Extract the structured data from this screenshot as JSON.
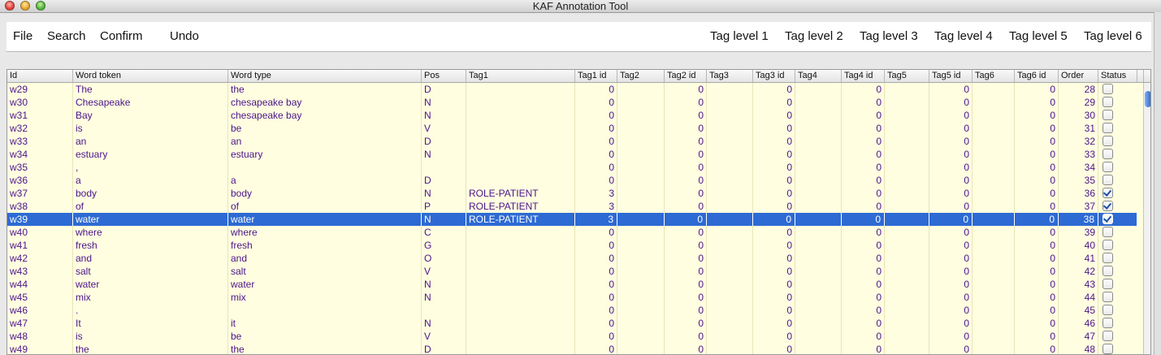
{
  "window": {
    "title": "KAF Annotation Tool"
  },
  "menu": {
    "left": [
      "File",
      "Search",
      "Confirm",
      "Undo"
    ],
    "right": [
      "Tag level 1",
      "Tag level 2",
      "Tag level 3",
      "Tag level 4",
      "Tag level 5",
      "Tag level 6"
    ]
  },
  "colors": {
    "selection": "#2d6ad3",
    "row_bg": "#fffee0",
    "text": "#4a148c"
  },
  "table": {
    "columns": [
      "Id",
      "Word token",
      "Word type",
      "Pos",
      "Tag1",
      "Tag1 id",
      "Tag2",
      "Tag2 id",
      "Tag3",
      "Tag3 id",
      "Tag4",
      "Tag4 id",
      "Tag5",
      "Tag5 id",
      "Tag6",
      "Tag6 id",
      "Order",
      "Status"
    ],
    "selected_id": "w39",
    "rows": [
      {
        "id": "w29",
        "token": "The",
        "type": "the",
        "pos": "D",
        "tag1": "",
        "tag1_id": "0",
        "tag2_id": "0",
        "tag3_id": "0",
        "tag4_id": "0",
        "tag5_id": "0",
        "tag6_id": "0",
        "order": "28",
        "status": false
      },
      {
        "id": "w30",
        "token": "Chesapeake",
        "type": "chesapeake bay",
        "pos": "N",
        "tag1": "",
        "tag1_id": "0",
        "tag2_id": "0",
        "tag3_id": "0",
        "tag4_id": "0",
        "tag5_id": "0",
        "tag6_id": "0",
        "order": "29",
        "status": false
      },
      {
        "id": "w31",
        "token": "Bay",
        "type": "chesapeake bay",
        "pos": "N",
        "tag1": "",
        "tag1_id": "0",
        "tag2_id": "0",
        "tag3_id": "0",
        "tag4_id": "0",
        "tag5_id": "0",
        "tag6_id": "0",
        "order": "30",
        "status": false
      },
      {
        "id": "w32",
        "token": "is",
        "type": "be",
        "pos": "V",
        "tag1": "",
        "tag1_id": "0",
        "tag2_id": "0",
        "tag3_id": "0",
        "tag4_id": "0",
        "tag5_id": "0",
        "tag6_id": "0",
        "order": "31",
        "status": false
      },
      {
        "id": "w33",
        "token": "an",
        "type": "an",
        "pos": "D",
        "tag1": "",
        "tag1_id": "0",
        "tag2_id": "0",
        "tag3_id": "0",
        "tag4_id": "0",
        "tag5_id": "0",
        "tag6_id": "0",
        "order": "32",
        "status": false
      },
      {
        "id": "w34",
        "token": "estuary",
        "type": "estuary",
        "pos": "N",
        "tag1": "",
        "tag1_id": "0",
        "tag2_id": "0",
        "tag3_id": "0",
        "tag4_id": "0",
        "tag5_id": "0",
        "tag6_id": "0",
        "order": "33",
        "status": false
      },
      {
        "id": "w35",
        "token": ",",
        "type": "",
        "pos": "",
        "tag1": "",
        "tag1_id": "0",
        "tag2_id": "0",
        "tag3_id": "0",
        "tag4_id": "0",
        "tag5_id": "0",
        "tag6_id": "0",
        "order": "34",
        "status": false
      },
      {
        "id": "w36",
        "token": "a",
        "type": "a",
        "pos": "D",
        "tag1": "",
        "tag1_id": "0",
        "tag2_id": "0",
        "tag3_id": "0",
        "tag4_id": "0",
        "tag5_id": "0",
        "tag6_id": "0",
        "order": "35",
        "status": false
      },
      {
        "id": "w37",
        "token": "body",
        "type": "body",
        "pos": "N",
        "tag1": "ROLE-PATIENT",
        "tag1_id": "3",
        "tag2_id": "0",
        "tag3_id": "0",
        "tag4_id": "0",
        "tag5_id": "0",
        "tag6_id": "0",
        "order": "36",
        "status": true
      },
      {
        "id": "w38",
        "token": "of",
        "type": "of",
        "pos": "P",
        "tag1": "ROLE-PATIENT",
        "tag1_id": "3",
        "tag2_id": "0",
        "tag3_id": "0",
        "tag4_id": "0",
        "tag5_id": "0",
        "tag6_id": "0",
        "order": "37",
        "status": true
      },
      {
        "id": "w39",
        "token": "water",
        "type": "water",
        "pos": "N",
        "tag1": "ROLE-PATIENT",
        "tag1_id": "3",
        "tag2_id": "0",
        "tag3_id": "0",
        "tag4_id": "0",
        "tag5_id": "0",
        "tag6_id": "0",
        "order": "38",
        "status": true
      },
      {
        "id": "w40",
        "token": "where",
        "type": "where",
        "pos": "C",
        "tag1": "",
        "tag1_id": "0",
        "tag2_id": "0",
        "tag3_id": "0",
        "tag4_id": "0",
        "tag5_id": "0",
        "tag6_id": "0",
        "order": "39",
        "status": false
      },
      {
        "id": "w41",
        "token": "fresh",
        "type": "fresh",
        "pos": "G",
        "tag1": "",
        "tag1_id": "0",
        "tag2_id": "0",
        "tag3_id": "0",
        "tag4_id": "0",
        "tag5_id": "0",
        "tag6_id": "0",
        "order": "40",
        "status": false
      },
      {
        "id": "w42",
        "token": "and",
        "type": "and",
        "pos": "O",
        "tag1": "",
        "tag1_id": "0",
        "tag2_id": "0",
        "tag3_id": "0",
        "tag4_id": "0",
        "tag5_id": "0",
        "tag6_id": "0",
        "order": "41",
        "status": false
      },
      {
        "id": "w43",
        "token": "salt",
        "type": "salt",
        "pos": "V",
        "tag1": "",
        "tag1_id": "0",
        "tag2_id": "0",
        "tag3_id": "0",
        "tag4_id": "0",
        "tag5_id": "0",
        "tag6_id": "0",
        "order": "42",
        "status": false
      },
      {
        "id": "w44",
        "token": "water",
        "type": "water",
        "pos": "N",
        "tag1": "",
        "tag1_id": "0",
        "tag2_id": "0",
        "tag3_id": "0",
        "tag4_id": "0",
        "tag5_id": "0",
        "tag6_id": "0",
        "order": "43",
        "status": false
      },
      {
        "id": "w45",
        "token": "mix",
        "type": "mix",
        "pos": "N",
        "tag1": "",
        "tag1_id": "0",
        "tag2_id": "0",
        "tag3_id": "0",
        "tag4_id": "0",
        "tag5_id": "0",
        "tag6_id": "0",
        "order": "44",
        "status": false
      },
      {
        "id": "w46",
        "token": ".",
        "type": "",
        "pos": "",
        "tag1": "",
        "tag1_id": "0",
        "tag2_id": "0",
        "tag3_id": "0",
        "tag4_id": "0",
        "tag5_id": "0",
        "tag6_id": "0",
        "order": "45",
        "status": false
      },
      {
        "id": "w47",
        "token": "It",
        "type": "it",
        "pos": "N",
        "tag1": "",
        "tag1_id": "0",
        "tag2_id": "0",
        "tag3_id": "0",
        "tag4_id": "0",
        "tag5_id": "0",
        "tag6_id": "0",
        "order": "46",
        "status": false
      },
      {
        "id": "w48",
        "token": "is",
        "type": "be",
        "pos": "V",
        "tag1": "",
        "tag1_id": "0",
        "tag2_id": "0",
        "tag3_id": "0",
        "tag4_id": "0",
        "tag5_id": "0",
        "tag6_id": "0",
        "order": "47",
        "status": false
      },
      {
        "id": "w49",
        "token": "the",
        "type": "the",
        "pos": "D",
        "tag1": "",
        "tag1_id": "0",
        "tag2_id": "0",
        "tag3_id": "0",
        "tag4_id": "0",
        "tag5_id": "0",
        "tag6_id": "0",
        "order": "48",
        "status": false
      }
    ]
  }
}
